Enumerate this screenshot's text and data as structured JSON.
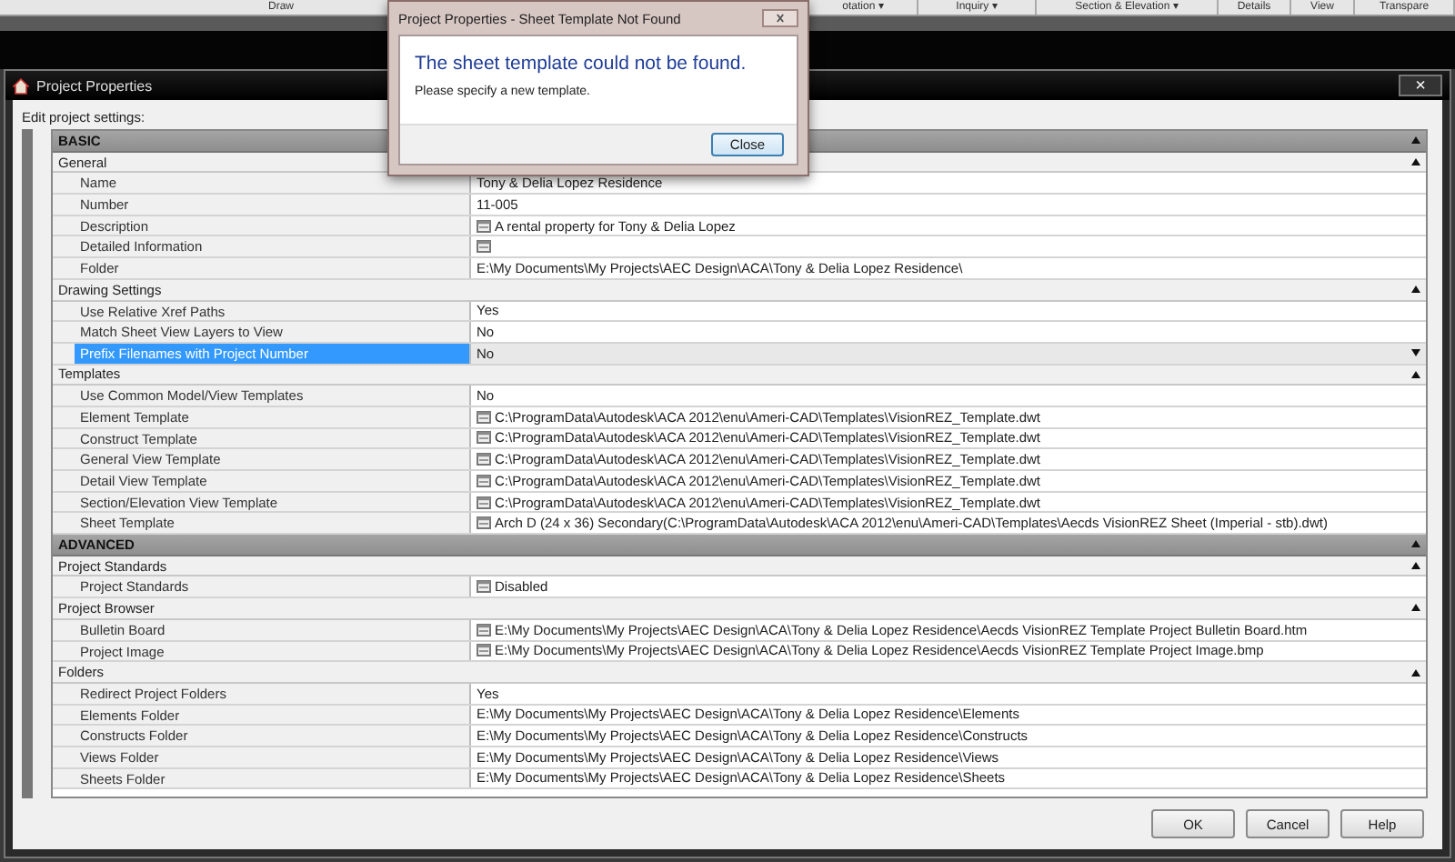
{
  "ribbon": {
    "panels": [
      "Draw",
      "otation ▾",
      "Inquiry ▾",
      "Section & Elevation ▾",
      "Details",
      "View",
      "Transpare"
    ]
  },
  "window": {
    "title": "Project Properties",
    "close": "×",
    "caption": "Edit project settings:",
    "sections": [
      {
        "title": "BASIC",
        "expanded": true,
        "groups": [
          {
            "title": "General",
            "expanded": true,
            "rows": [
              {
                "label": "Name",
                "value": "Tony & Delia Lopez Residence",
                "icon": false,
                "selected": false
              },
              {
                "label": "Number",
                "value": "11-005",
                "icon": false,
                "selected": false
              },
              {
                "label": "Description",
                "value": "A rental property for Tony & Delia Lopez",
                "icon": true,
                "selected": false
              },
              {
                "label": "Detailed Information",
                "value": "",
                "icon": true,
                "selected": false
              },
              {
                "label": "Folder",
                "value": "E:\\My Documents\\My Projects\\AEC Design\\ACA\\Tony & Delia Lopez Residence\\",
                "icon": false,
                "selected": false
              }
            ]
          },
          {
            "title": "Drawing Settings",
            "expanded": true,
            "rows": [
              {
                "label": "Use Relative Xref Paths",
                "value": "Yes",
                "icon": false,
                "selected": false
              },
              {
                "label": "Match Sheet View Layers to View",
                "value": "No",
                "icon": false,
                "selected": false
              },
              {
                "label": "Prefix Filenames with Project Number",
                "value": "No",
                "icon": false,
                "selected": true
              }
            ]
          },
          {
            "title": "Templates",
            "expanded": true,
            "rows": [
              {
                "label": "Use Common Model/View Templates",
                "value": "No",
                "icon": false,
                "selected": false
              },
              {
                "label": "Element Template",
                "value": "C:\\ProgramData\\Autodesk\\ACA 2012\\enu\\Ameri-CAD\\Templates\\VisionREZ_Template.dwt",
                "icon": true,
                "selected": false
              },
              {
                "label": "Construct Template",
                "value": "C:\\ProgramData\\Autodesk\\ACA 2012\\enu\\Ameri-CAD\\Templates\\VisionREZ_Template.dwt",
                "icon": true,
                "selected": false
              },
              {
                "label": "General View Template",
                "value": "C:\\ProgramData\\Autodesk\\ACA 2012\\enu\\Ameri-CAD\\Templates\\VisionREZ_Template.dwt",
                "icon": true,
                "selected": false
              },
              {
                "label": "Detail View Template",
                "value": "C:\\ProgramData\\Autodesk\\ACA 2012\\enu\\Ameri-CAD\\Templates\\VisionREZ_Template.dwt",
                "icon": true,
                "selected": false
              },
              {
                "label": "Section/Elevation View Template",
                "value": "C:\\ProgramData\\Autodesk\\ACA 2012\\enu\\Ameri-CAD\\Templates\\VisionREZ_Template.dwt",
                "icon": true,
                "selected": false
              },
              {
                "label": "Sheet Template",
                "value": "Arch D (24 x 36) Secondary(C:\\ProgramData\\Autodesk\\ACA 2012\\enu\\Ameri-CAD\\Templates\\Aecds VisionREZ Sheet (Imperial - stb).dwt)",
                "icon": true,
                "selected": false
              }
            ]
          }
        ]
      },
      {
        "title": "ADVANCED",
        "expanded": true,
        "groups": [
          {
            "title": "Project Standards",
            "expanded": true,
            "rows": [
              {
                "label": "Project Standards",
                "value": "Disabled",
                "icon": true,
                "selected": false
              }
            ]
          },
          {
            "title": "Project Browser",
            "expanded": true,
            "rows": [
              {
                "label": "Bulletin Board",
                "value": "E:\\My Documents\\My Projects\\AEC Design\\ACA\\Tony & Delia Lopez Residence\\Aecds VisionREZ Template Project Bulletin Board.htm",
                "icon": true,
                "selected": false
              },
              {
                "label": "Project Image",
                "value": "E:\\My Documents\\My Projects\\AEC Design\\ACA\\Tony & Delia Lopez Residence\\Aecds VisionREZ Template Project Image.bmp",
                "icon": true,
                "selected": false
              }
            ]
          },
          {
            "title": "Folders",
            "expanded": true,
            "rows": [
              {
                "label": "Redirect Project Folders",
                "value": "Yes",
                "icon": false,
                "selected": false
              },
              {
                "label": "Elements Folder",
                "value": "E:\\My Documents\\My Projects\\AEC Design\\ACA\\Tony & Delia Lopez Residence\\Elements",
                "icon": false,
                "selected": false
              },
              {
                "label": "Constructs Folder",
                "value": "E:\\My Documents\\My Projects\\AEC Design\\ACA\\Tony & Delia Lopez Residence\\Constructs",
                "icon": false,
                "selected": false
              },
              {
                "label": "Views Folder",
                "value": "E:\\My Documents\\My Projects\\AEC Design\\ACA\\Tony & Delia Lopez Residence\\Views",
                "icon": false,
                "selected": false
              },
              {
                "label": "Sheets Folder",
                "value": "E:\\My Documents\\My Projects\\AEC Design\\ACA\\Tony & Delia Lopez Residence\\Sheets",
                "icon": false,
                "selected": false
              }
            ]
          }
        ]
      }
    ],
    "buttons": [
      "OK",
      "Cancel",
      "Help"
    ]
  },
  "alert": {
    "title": "Project Properties - Sheet Template Not Found",
    "heading": "The sheet template could not be found.",
    "message": "Please specify a new template.",
    "button": "Close"
  }
}
